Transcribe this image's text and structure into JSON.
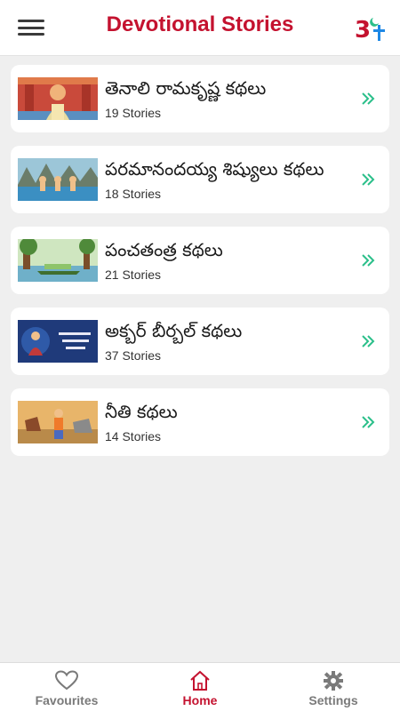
{
  "header": {
    "title": "Devotional Stories",
    "menu_icon": "hamburger-menu-icon",
    "logo_icon": "om-religions-logo-icon"
  },
  "categories": [
    {
      "title": "తెనాలి రామకృష్ణ కథలు",
      "count": "19 Stories"
    },
    {
      "title": "పరమానందయ్య శిష్యులు కథలు",
      "count": "18 Stories"
    },
    {
      "title": "పంచతంత్ర కథలు",
      "count": "21 Stories"
    },
    {
      "title": "అక్బర్ బీర్బల్ కథలు",
      "count": "37 Stories"
    },
    {
      "title": "నీతి కథలు",
      "count": "14 Stories"
    }
  ],
  "tabs": [
    {
      "label": "Favourites",
      "icon": "heart-icon"
    },
    {
      "label": "Home",
      "icon": "home-icon"
    },
    {
      "label": "Settings",
      "icon": "gear-icon"
    }
  ],
  "colors": {
    "brand": "#c4122f",
    "chevron": "#2bbf8a",
    "background": "#efefef",
    "inactive_tab": "#7a7a7a"
  }
}
